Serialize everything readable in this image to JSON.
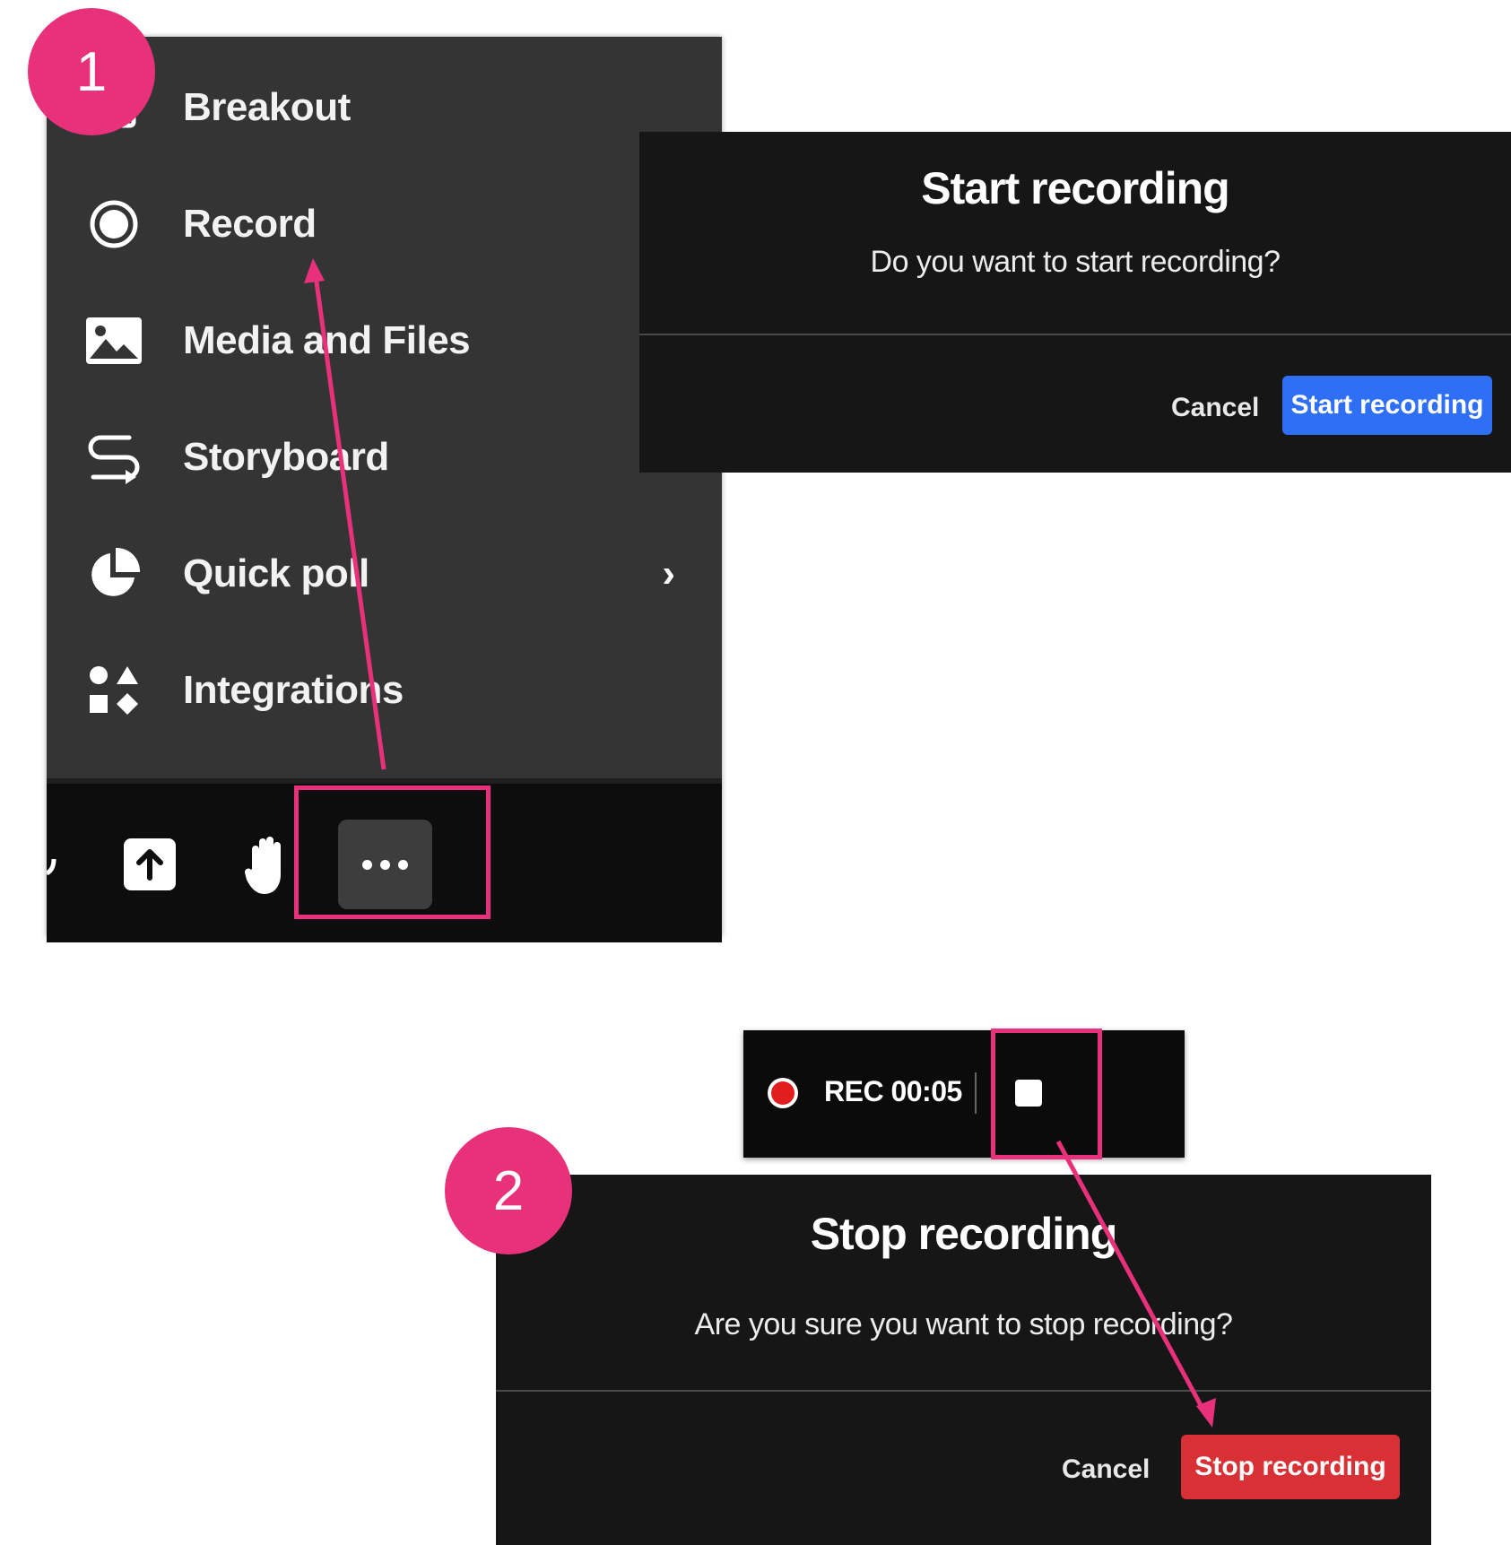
{
  "menu": {
    "items": [
      {
        "label": "Breakout",
        "icon": "breakout-icon",
        "has_submenu": false
      },
      {
        "label": "Record",
        "icon": "record-icon",
        "has_submenu": false
      },
      {
        "label": "Media and Files",
        "icon": "image-icon",
        "has_submenu": false
      },
      {
        "label": "Storyboard",
        "icon": "storyboard-icon",
        "has_submenu": false
      },
      {
        "label": "Quick poll",
        "icon": "pie-chart-icon",
        "has_submenu": true,
        "submenu_indicator": "›"
      },
      {
        "label": "Integrations",
        "icon": "shapes-icon",
        "has_submenu": false
      }
    ]
  },
  "toolbar": {
    "buttons": [
      {
        "icon": "share-screen-icon"
      },
      {
        "icon": "raise-hand-icon"
      },
      {
        "icon": "more-options-icon"
      }
    ]
  },
  "start_dialog": {
    "title": "Start recording",
    "message": "Do you want to start recording?",
    "cancel_label": "Cancel",
    "confirm_label": "Start recording",
    "confirm_color": "#2f6ff5"
  },
  "recording_bar": {
    "label": "REC 00:05",
    "indicator_color": "#e21d1d",
    "stop_icon": "stop-icon"
  },
  "stop_dialog": {
    "title": "Stop recording",
    "message": "Are you sure you want to stop recording?",
    "cancel_label": "Cancel",
    "confirm_label": "Stop recording",
    "confirm_color": "#d93036"
  },
  "annotations": {
    "step1": "1",
    "step2": "2",
    "accent_color": "#e8317a"
  }
}
